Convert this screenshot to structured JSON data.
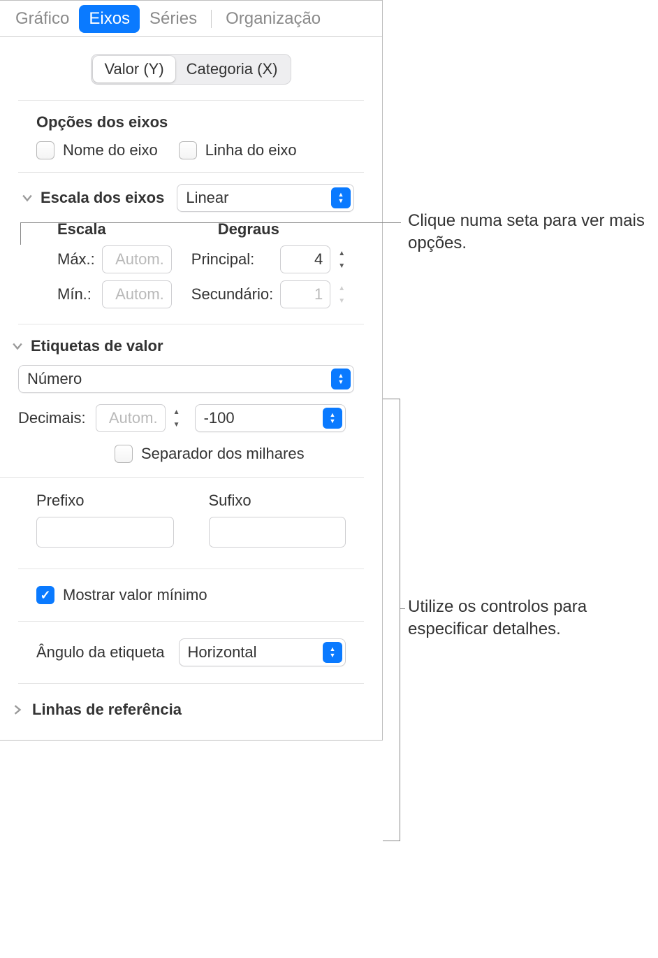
{
  "top_tabs": {
    "grafico": "Gráfico",
    "eixos": "Eixos",
    "series": "Séries",
    "organizacao": "Organização"
  },
  "segmented": {
    "valor_y": "Valor (Y)",
    "categoria_x": "Categoria (X)"
  },
  "axis_options": {
    "title": "Opções dos eixos",
    "axis_name": "Nome do eixo",
    "axis_line": "Linha do eixo"
  },
  "axis_scale": {
    "title": "Escala dos eixos",
    "select_value": "Linear",
    "scale_head": "Escala",
    "steps_head": "Degraus",
    "max_label": "Máx.:",
    "max_placeholder": "Autom.",
    "min_label": "Mín.:",
    "min_placeholder": "Autom.",
    "major_label": "Principal:",
    "major_value": "4",
    "minor_label": "Secundário:",
    "minor_value": "1"
  },
  "value_labels": {
    "title": "Etiquetas de valor",
    "format_select": "Número",
    "decimals_label": "Decimais:",
    "decimals_placeholder": "Autom.",
    "neg_select": "-100",
    "thousands_label": "Separador dos milhares"
  },
  "prefix_suffix": {
    "prefix_label": "Prefixo",
    "suffix_label": "Sufixo"
  },
  "show_min": {
    "label": "Mostrar valor mínimo"
  },
  "label_angle": {
    "label": "Ângulo da etiqueta",
    "select_value": "Horizontal"
  },
  "reference_lines": {
    "label": "Linhas de referência"
  },
  "callouts": {
    "c1": "Clique numa seta para ver mais opções.",
    "c2": "Utilize os controlos para especificar detalhes."
  }
}
